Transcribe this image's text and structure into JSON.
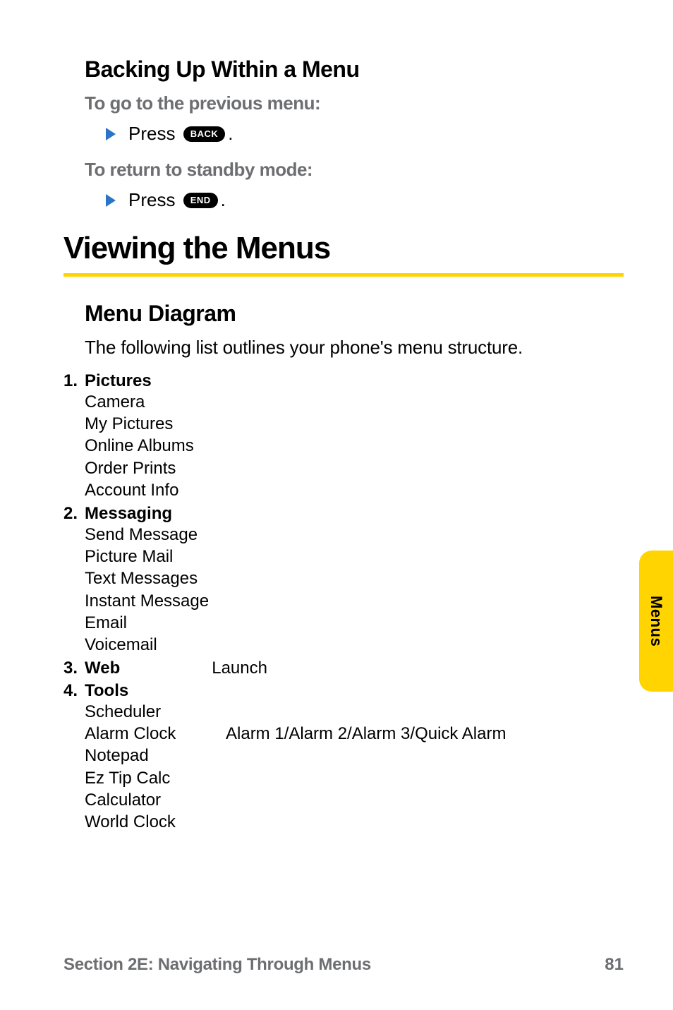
{
  "backing": {
    "heading": "Backing Up Within a Menu",
    "prev_sub": "To go to the previous menu:",
    "prev_press": "Press",
    "prev_key": "BACK",
    "standby_sub": "To return to standby mode:",
    "standby_press": "Press",
    "standby_key": "END",
    "period": "."
  },
  "viewing": {
    "heading": "Viewing the Menus",
    "diagram_heading": "Menu Diagram",
    "intro": "The following list outlines your phone's menu structure."
  },
  "menus": [
    {
      "num": "1.",
      "title": "Pictures",
      "items": [
        {
          "label": "Camera",
          "detail": ""
        },
        {
          "label": "My Pictures",
          "detail": ""
        },
        {
          "label": "Online Albums",
          "detail": ""
        },
        {
          "label": "Order Prints",
          "detail": ""
        },
        {
          "label": "Account Info",
          "detail": ""
        }
      ]
    },
    {
      "num": "2.",
      "title": "Messaging",
      "items": [
        {
          "label": "Send Message",
          "detail": ""
        },
        {
          "label": "Picture Mail",
          "detail": ""
        },
        {
          "label": "Text Messages",
          "detail": ""
        },
        {
          "label": "Instant Message",
          "detail": ""
        },
        {
          "label": "Email",
          "detail": ""
        },
        {
          "label": "Voicemail",
          "detail": ""
        }
      ]
    },
    {
      "num": "3.",
      "title": "Web",
      "title_detail": "Launch",
      "items": []
    },
    {
      "num": "4.",
      "title": "Tools",
      "items": [
        {
          "label": "Scheduler",
          "detail": ""
        },
        {
          "label": "Alarm Clock",
          "detail": "Alarm 1/Alarm 2/Alarm 3/Quick Alarm"
        },
        {
          "label": "Notepad",
          "detail": ""
        },
        {
          "label": "Ez Tip Calc",
          "detail": ""
        },
        {
          "label": "Calculator",
          "detail": ""
        },
        {
          "label": "World Clock",
          "detail": ""
        }
      ]
    }
  ],
  "side_tab": "Menus",
  "footer": {
    "section": "Section 2E: Navigating Through Menus",
    "page": "81"
  }
}
